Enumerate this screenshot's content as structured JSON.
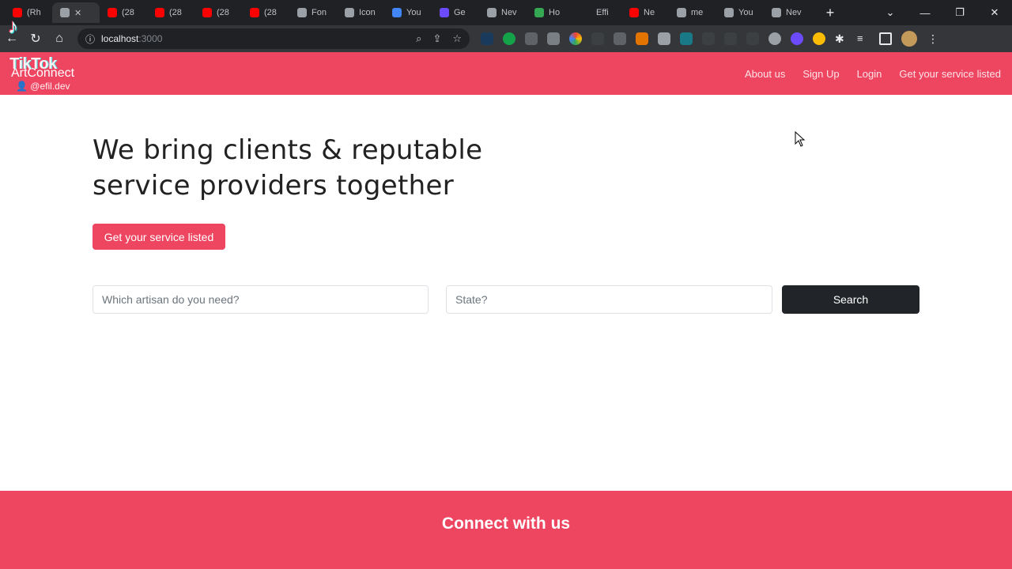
{
  "browser": {
    "tabs": [
      {
        "label": "(Rh",
        "color": "#ff0000"
      },
      {
        "label": "",
        "color": "#9aa0a6"
      },
      {
        "label": "(28",
        "color": "#ff0000"
      },
      {
        "label": "(28",
        "color": "#ff0000"
      },
      {
        "label": "(28",
        "color": "#ff0000"
      },
      {
        "label": "(28",
        "color": "#ff0000"
      },
      {
        "label": "Fon",
        "color": "#9aa0a6"
      },
      {
        "label": "Icon",
        "color": "#9aa0a6"
      },
      {
        "label": "You",
        "color": "#4285f4"
      },
      {
        "label": "Ge",
        "color": "#6c4bff"
      },
      {
        "label": "Nev",
        "color": "#9aa0a6"
      },
      {
        "label": "Ho",
        "color": "#34a853"
      },
      {
        "label": "Effi",
        "color": "#202124"
      },
      {
        "label": "Ne",
        "color": "#ff0000"
      },
      {
        "label": "me",
        "color": "#9aa0a6"
      },
      {
        "label": "You",
        "color": "#9aa0a6"
      },
      {
        "label": "Nev",
        "color": "#9aa0a6"
      }
    ],
    "new_tab": "+",
    "url": "localhost",
    "port": ":3000"
  },
  "site": {
    "brand": "ArtConnect",
    "nav": [
      "About us",
      "Sign Up",
      "Login",
      "Get your service listed"
    ]
  },
  "hero": {
    "title": "We bring clients & reputable service providers together",
    "cta": "Get your service listed"
  },
  "search": {
    "artisan_placeholder": "Which artisan do you need?",
    "state_placeholder": "State?",
    "button": "Search"
  },
  "footer": {
    "title": "Connect with us"
  },
  "overlay": {
    "tiktok": "TikTok",
    "handle": "@efil.dev"
  },
  "colors": {
    "brand": "#ee4560",
    "dark_button": "#212529"
  }
}
